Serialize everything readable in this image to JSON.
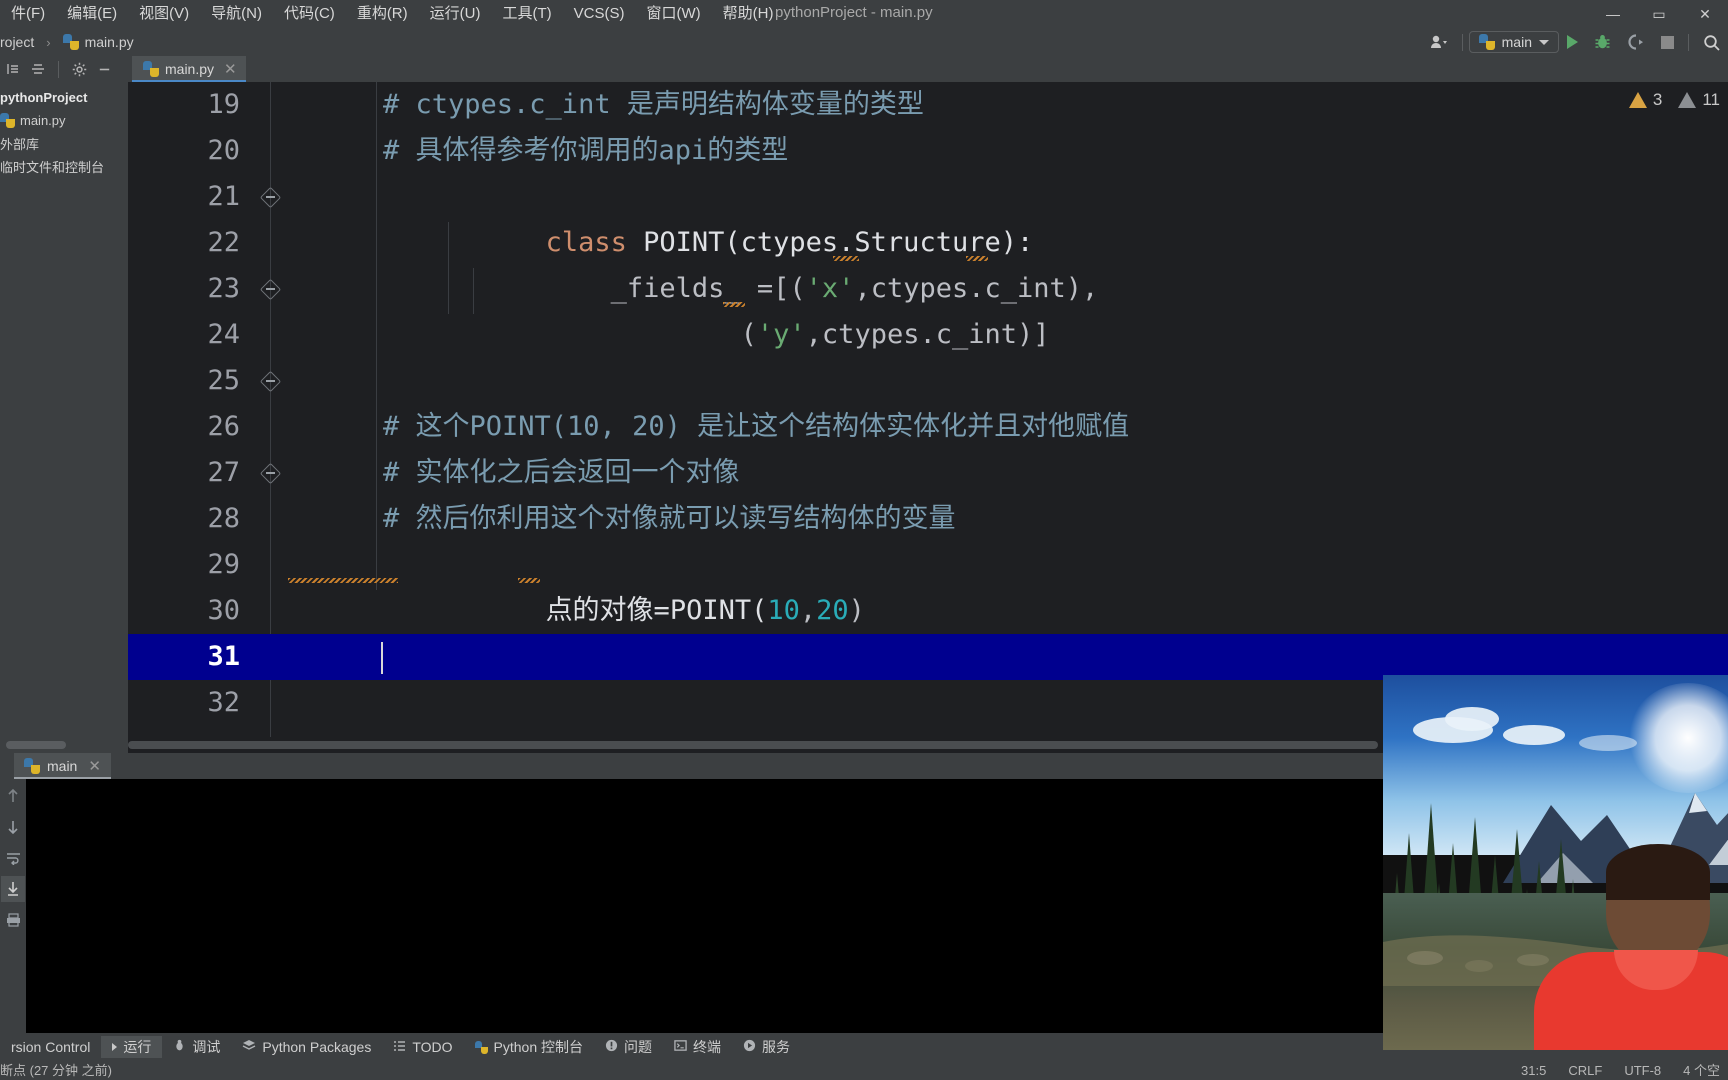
{
  "window": {
    "title": "pythonProject - main.py",
    "controls": {
      "minimize": "—",
      "maximize": "▭",
      "close": "✕"
    }
  },
  "menubar": {
    "items": [
      {
        "label": "件(F)",
        "mnemonic": "F"
      },
      {
        "label": "编辑(E)",
        "mnemonic": "E"
      },
      {
        "label": "视图(V)",
        "mnemonic": "V"
      },
      {
        "label": "导航(N)",
        "mnemonic": "N"
      },
      {
        "label": "代码(C)",
        "mnemonic": "C"
      },
      {
        "label": "重构(R)",
        "mnemonic": "R"
      },
      {
        "label": "运行(U)",
        "mnemonic": "U"
      },
      {
        "label": "工具(T)",
        "mnemonic": "T"
      },
      {
        "label": "VCS(S)",
        "mnemonic": "S"
      },
      {
        "label": "窗口(W)",
        "mnemonic": "W"
      },
      {
        "label": "帮助(H)",
        "mnemonic": "H"
      }
    ]
  },
  "navbar": {
    "breadcrumb": [
      "roject",
      "main.py"
    ],
    "separator": "›",
    "run_config": "main",
    "actions": [
      "user-icon",
      "run-icon",
      "debug-icon",
      "coverage-icon",
      "stop-icon",
      "search-icon"
    ]
  },
  "project_panel": {
    "toolbar_icons": [
      "collapse-all-icon",
      "expand-icon",
      "settings-gear-icon",
      "hide-icon"
    ],
    "tree": [
      {
        "label": "pythonProject",
        "bold": true,
        "icon": "folder-icon"
      },
      {
        "label": "main.py",
        "bold": false,
        "icon": "python-file-icon"
      },
      {
        "label": "外部库",
        "bold": false,
        "icon": "library-icon"
      },
      {
        "label": "临时文件和控制台",
        "bold": false,
        "icon": "scratch-icon"
      }
    ]
  },
  "editor": {
    "tab": {
      "label": "main.py",
      "close": "✕",
      "icon": "python-file-icon"
    },
    "warnings": {
      "error_count": "3",
      "weak_warning_count": "11"
    },
    "lines": [
      {
        "num": "19",
        "fold": "none",
        "indent_guides": 0,
        "tokens": [
          {
            "t": "comment",
            "v": "# ctypes.c_int 是声明结构体变量的类型"
          }
        ]
      },
      {
        "num": "20",
        "fold": "collapsed",
        "indent_guides": 0,
        "tokens": [
          {
            "t": "comment",
            "v": "# 具体得参考你调用的api的类型"
          }
        ]
      },
      {
        "num": "21",
        "fold": "expanded",
        "indent_guides": 0,
        "tokens": [
          {
            "t": "keyword",
            "v": "class"
          },
          {
            "t": "plain",
            "v": " POINT(ctypes.Structure):"
          }
        ]
      },
      {
        "num": "22",
        "fold": "expanded",
        "indent_guides": 1,
        "tokens": [
          {
            "t": "plain",
            "v": "    _fields_ =[("
          },
          {
            "t": "string",
            "v": "'x'"
          },
          {
            "t": "plain",
            "v": ",ctypes.c_int),"
          }
        ]
      },
      {
        "num": "23",
        "fold": "collapsed",
        "indent_guides": 2,
        "tokens": [
          {
            "t": "plain",
            "v": "            ("
          },
          {
            "t": "string",
            "v": "'y'"
          },
          {
            "t": "plain",
            "v": ",ctypes.c_int)]"
          }
        ]
      },
      {
        "num": "24",
        "fold": "none",
        "indent_guides": 0,
        "tokens": []
      },
      {
        "num": "25",
        "fold": "none",
        "indent_guides": 0,
        "tokens": []
      },
      {
        "num": "26",
        "fold": "expanded",
        "indent_guides": 0,
        "tokens": [
          {
            "t": "comment",
            "v": "# 这个POINT(10, 20) 是让这个结构体实体化并且对他赋值"
          }
        ]
      },
      {
        "num": "27",
        "fold": "none",
        "indent_guides": 0,
        "tokens": [
          {
            "t": "comment",
            "v": "# 实体化之后会返回一个对像"
          }
        ]
      },
      {
        "num": "28",
        "fold": "collapsed",
        "indent_guides": 0,
        "tokens": [
          {
            "t": "comment",
            "v": "# 然后你利用这个对像就可以读写结构体的变量"
          }
        ]
      },
      {
        "num": "29",
        "fold": "collapsed",
        "indent_guides": 0,
        "tokens": [
          {
            "t": "plain",
            "v": "点的对像=POINT("
          },
          {
            "t": "number",
            "v": "10"
          },
          {
            "t": "plain",
            "v": ","
          },
          {
            "t": "number",
            "v": "20"
          },
          {
            "t": "plain",
            "v": ")"
          }
        ]
      },
      {
        "num": "30",
        "fold": "none",
        "indent_guides": 0,
        "tokens": []
      },
      {
        "num": "31",
        "fold": "none",
        "indent_guides": 0,
        "current": true,
        "tokens": []
      },
      {
        "num": "32",
        "fold": "none",
        "indent_guides": 0,
        "tokens": []
      }
    ]
  },
  "run_window": {
    "tab": {
      "label": "main",
      "close": "✕",
      "icon": "python-run-icon"
    },
    "sidebar_icons": [
      "scroll-up-icon",
      "scroll-down-icon",
      "soft-wrap-icon",
      "scroll-to-end-icon",
      "print-icon"
    ],
    "console_output": ""
  },
  "bottom_toolbar": {
    "items": [
      {
        "label": "rsion Control",
        "icon": "version-control-icon",
        "active": false
      },
      {
        "label": "运行",
        "icon": "run-icon",
        "active": true
      },
      {
        "label": "调试",
        "icon": "debug-icon",
        "active": false
      },
      {
        "label": "Python Packages",
        "icon": "packages-icon",
        "active": false
      },
      {
        "label": "TODO",
        "icon": "todo-icon",
        "active": false
      },
      {
        "label": "Python 控制台",
        "icon": "python-console-icon",
        "active": false
      },
      {
        "label": "问题",
        "icon": "problems-icon",
        "active": false
      },
      {
        "label": "终端",
        "icon": "terminal-icon",
        "active": false
      },
      {
        "label": "服务",
        "icon": "services-icon",
        "active": false
      }
    ]
  },
  "statusbar": {
    "left": "断点 (27 分钟 之前)",
    "right": [
      "31:5",
      "CRLF",
      "UTF-8",
      "4 个空"
    ]
  },
  "colors": {
    "chrome": "#3c3f41",
    "editor_bg": "#1e1f22",
    "current_line": "#00008f",
    "accent_blue": "#4a88c7",
    "comment": "#7a9cb0",
    "keyword": "#cf8e6d",
    "string": "#6aab73",
    "number": "#2aacb8",
    "warn_yellow": "#d9a343"
  }
}
